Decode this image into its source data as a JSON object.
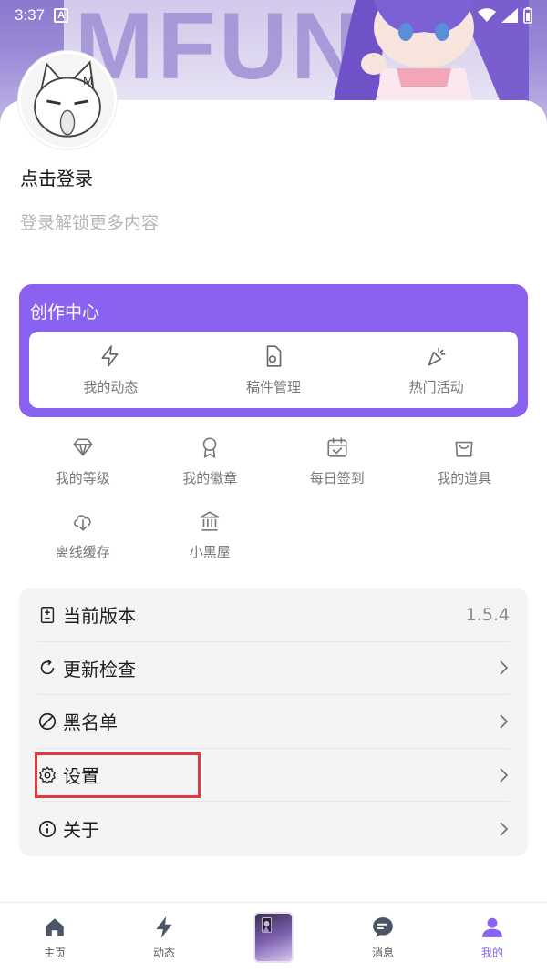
{
  "status_bar": {
    "time": "3:37",
    "notification_badge": "A"
  },
  "banner": {
    "word": "MFUN"
  },
  "profile": {
    "login_title": "点击登录",
    "login_subtitle": "登录解锁更多内容"
  },
  "creator_center": {
    "title": "创作中心",
    "items": [
      {
        "label": "我的动态",
        "icon": "lightning-icon"
      },
      {
        "label": "稿件管理",
        "icon": "draft-file-icon"
      },
      {
        "label": "热门活动",
        "icon": "party-popper-icon"
      }
    ]
  },
  "grid": {
    "items": [
      {
        "label": "我的等级",
        "icon": "diamond-icon"
      },
      {
        "label": "我的徽章",
        "icon": "badge-icon"
      },
      {
        "label": "每日签到",
        "icon": "calendar-check-icon"
      },
      {
        "label": "我的道具",
        "icon": "shopping-bag-icon"
      },
      {
        "label": "离线缓存",
        "icon": "cloud-download-icon"
      },
      {
        "label": "小黑屋",
        "icon": "bank-icon"
      }
    ]
  },
  "settings_list": {
    "rows": [
      {
        "label": "当前版本",
        "value": "1.5.4",
        "icon": "version-icon"
      },
      {
        "label": "更新检查",
        "icon": "refresh-icon"
      },
      {
        "label": "黑名单",
        "icon": "block-icon"
      },
      {
        "label": "设置",
        "icon": "gear-icon"
      },
      {
        "label": "关于",
        "icon": "info-icon"
      }
    ]
  },
  "bottom_nav": {
    "items": [
      {
        "label": "主页",
        "icon": "home-icon"
      },
      {
        "label": "动态",
        "icon": "lightning-icon"
      },
      {
        "label": "",
        "icon": "center-art-icon"
      },
      {
        "label": "消息",
        "icon": "message-icon"
      },
      {
        "label": "我的",
        "icon": "user-icon",
        "active": true
      }
    ]
  },
  "colors": {
    "accent": "#8a62f0",
    "highlight_box": "#e0393e",
    "muted_text": "#b5b5b5"
  }
}
